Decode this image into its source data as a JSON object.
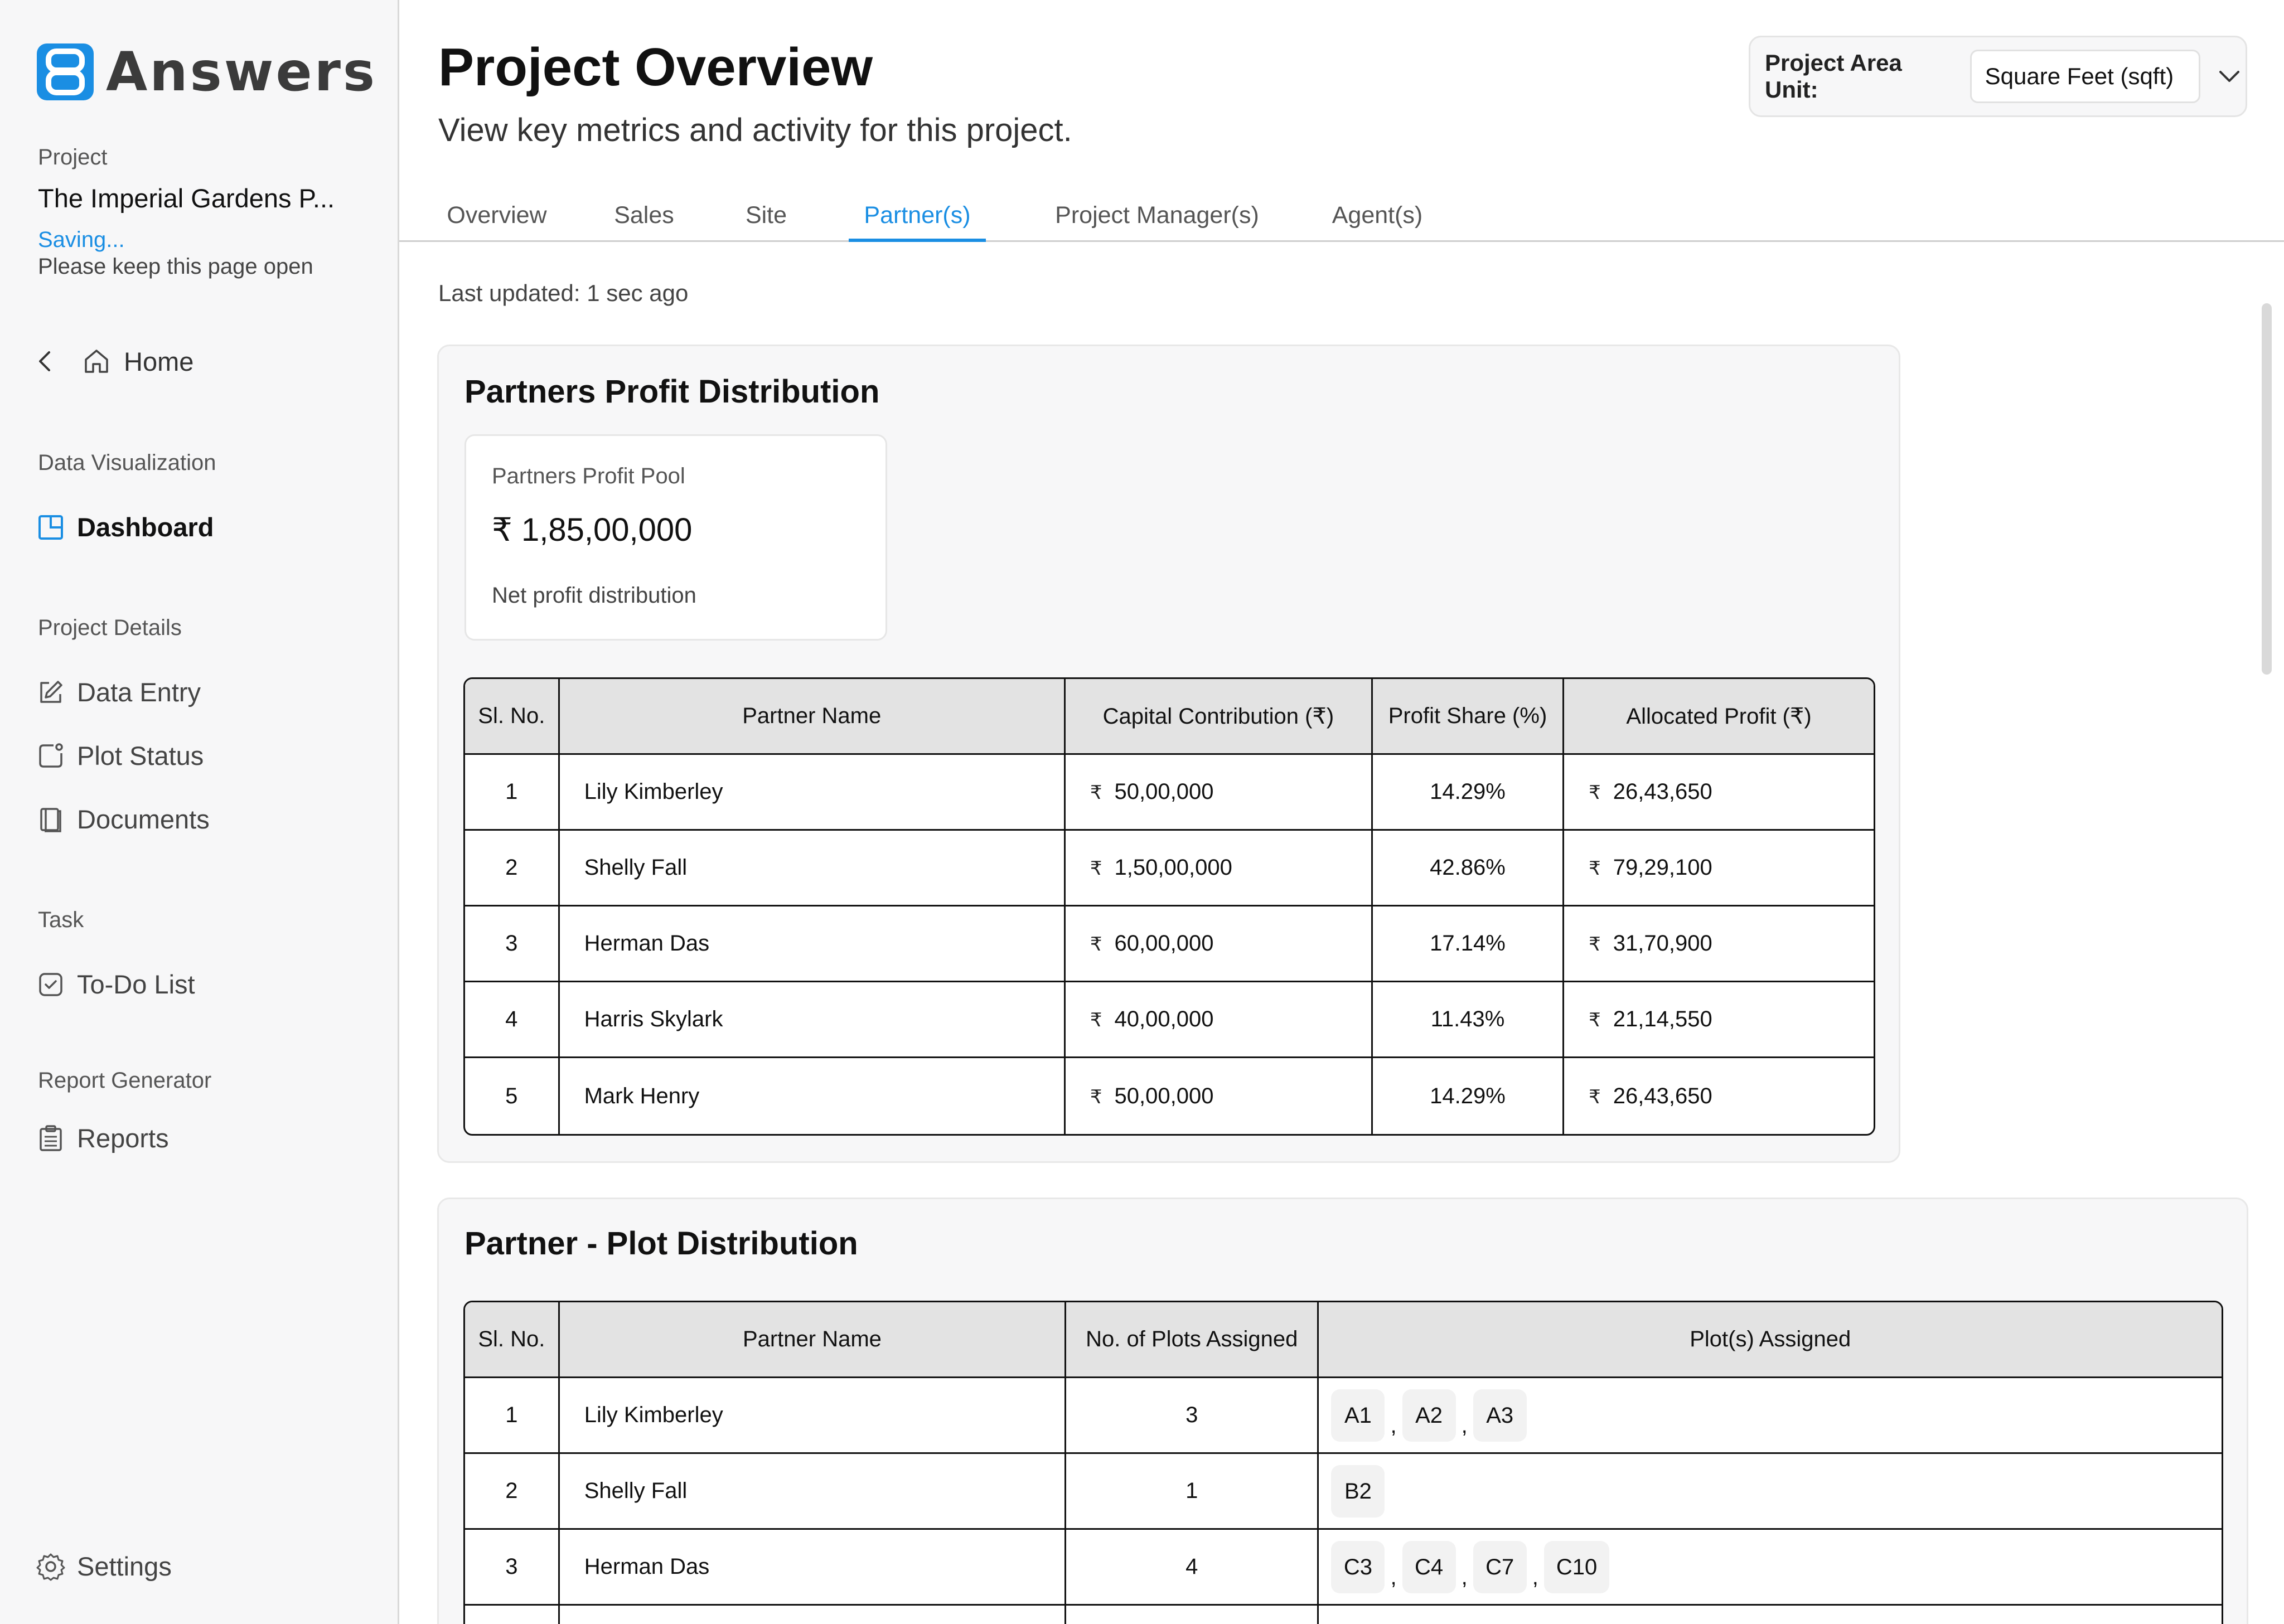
{
  "brand": {
    "name": "Answers"
  },
  "sidebar": {
    "project_caption": "Project",
    "project_name": "The Imperial Gardens P...",
    "saving_text": "Saving...",
    "keep_open_text": "Please keep this page open",
    "home_label": "Home",
    "sections": {
      "data_visualization": "Data Visualization",
      "project_details": "Project Details",
      "task": "Task",
      "report_generator": "Report Generator"
    },
    "items": {
      "dashboard": "Dashboard",
      "data_entry": "Data Entry",
      "plot_status": "Plot Status",
      "documents": "Documents",
      "todo": "To-Do List",
      "reports": "Reports",
      "settings": "Settings"
    }
  },
  "header": {
    "title": "Project Overview",
    "subtitle": "View key metrics and activity for this project.",
    "unit_label": "Project Area Unit:",
    "unit_value": "Square Feet (sqft)"
  },
  "tabs": {
    "overview": "Overview",
    "sales": "Sales",
    "site": "Site",
    "partners": "Partner(s)",
    "project_managers": "Project Manager(s)",
    "agents": "Agent(s)",
    "active": "Partner(s)"
  },
  "last_updated": "Last updated: 1 sec ago",
  "profit_section": {
    "title": "Partners Profit Distribution",
    "pool_label": "Partners Profit Pool",
    "pool_value": "₹ 1,85,00,000",
    "pool_note": "Net profit distribution",
    "columns": [
      "Sl. No.",
      "Partner Name",
      "Capital Contribution (₹)",
      "Profit Share (%)",
      "Allocated Profit (₹)"
    ],
    "currency_symbol": "₹",
    "rows": [
      {
        "sl": "1",
        "name": "Lily Kimberley",
        "capital": "50,00,000",
        "share": "14.29%",
        "profit": "26,43,650"
      },
      {
        "sl": "2",
        "name": "Shelly Fall",
        "capital": "1,50,00,000",
        "share": "42.86%",
        "profit": "79,29,100"
      },
      {
        "sl": "3",
        "name": "Herman Das",
        "capital": "60,00,000",
        "share": "17.14%",
        "profit": "31,70,900"
      },
      {
        "sl": "4",
        "name": "Harris Skylark",
        "capital": "40,00,000",
        "share": "11.43%",
        "profit": "21,14,550"
      },
      {
        "sl": "5",
        "name": "Mark Henry",
        "capital": "50,00,000",
        "share": "14.29%",
        "profit": "26,43,650"
      }
    ]
  },
  "plot_section": {
    "title": "Partner - Plot Distribution",
    "columns": [
      "Sl. No.",
      "Partner Name",
      "No. of Plots Assigned",
      "Plot(s) Assigned"
    ],
    "separator": ",",
    "rows": [
      {
        "sl": "1",
        "name": "Lily Kimberley",
        "count": "3",
        "plots": [
          "A1",
          "A2",
          "A3"
        ]
      },
      {
        "sl": "2",
        "name": "Shelly Fall",
        "count": "1",
        "plots": [
          "B2"
        ]
      },
      {
        "sl": "3",
        "name": "Herman Das",
        "count": "4",
        "plots": [
          "C3",
          "C4",
          "C7",
          "C10"
        ]
      }
    ]
  },
  "colors": {
    "accent": "#1a8ee3",
    "sidebar_bg": "#f7f7f8",
    "header_cell": "#e3e3e3"
  },
  "icons": [
    "logo-8-icon",
    "chevron-left-icon",
    "home-icon",
    "dashboard-icon",
    "edit-icon",
    "plot-status-icon",
    "documents-icon",
    "todo-icon",
    "clipboard-icon",
    "settings-gear-icon",
    "chevron-down-icon"
  ]
}
